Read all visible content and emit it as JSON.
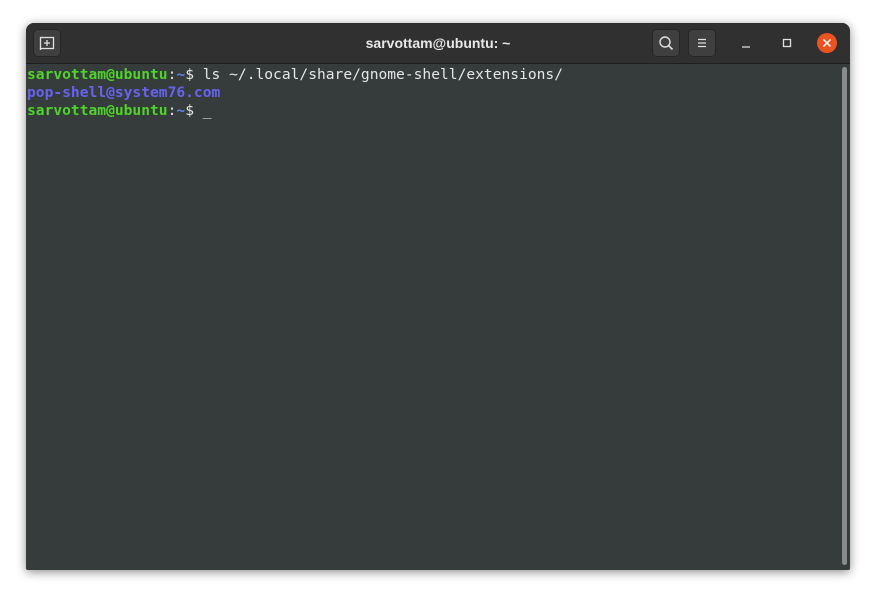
{
  "window": {
    "title": "sarvottam@ubuntu: ~"
  },
  "titlebar": {
    "new_tab_icon": "new-tab-icon",
    "search_icon": "search-icon",
    "menu_icon": "hamburger-menu-icon",
    "minimize_icon": "minimize-icon",
    "maximize_icon": "maximize-icon",
    "close_icon": "close-icon",
    "close_color": "#e95420"
  },
  "terminal": {
    "lines": [
      {
        "user": "sarvottam@ubuntu",
        "colon": ":",
        "path": "~",
        "dollar": "$ ",
        "command": "ls ~/.local/share/gnome-shell/extensions/"
      },
      {
        "output": "pop-shell@system76.com"
      },
      {
        "user": "sarvottam@ubuntu",
        "colon": ":",
        "path": "~",
        "dollar": "$ ",
        "cursor": "_"
      }
    ]
  },
  "colors": {
    "background": "#363b3b",
    "prompt_user": "#4ed42a",
    "prompt_path": "#5d82e8",
    "directory": "#6663f0"
  }
}
